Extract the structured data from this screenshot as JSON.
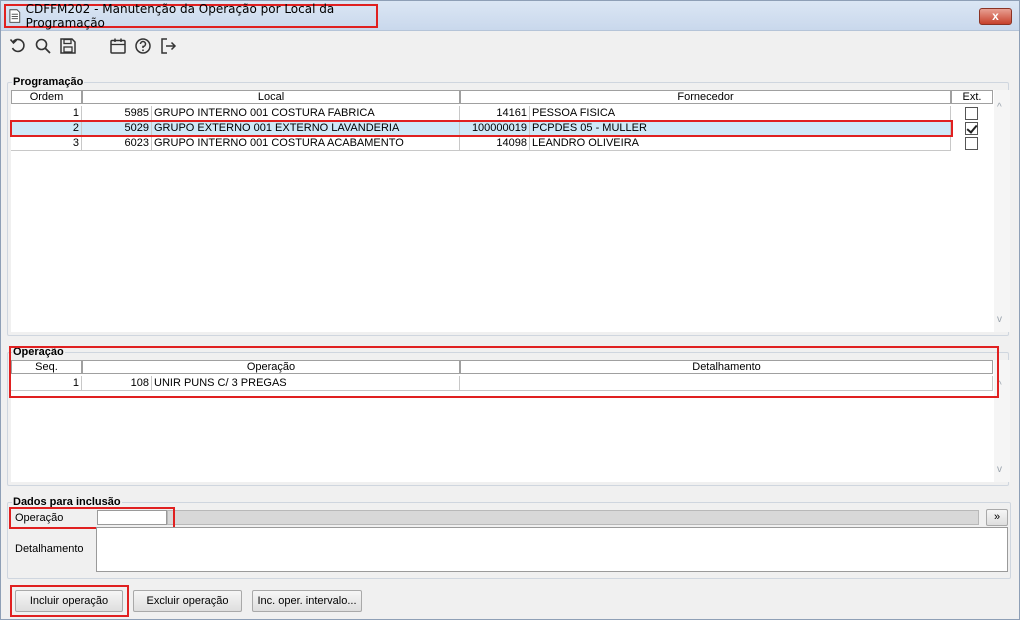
{
  "window": {
    "title": "CDFFM202 - Manutenção da Operação por Local da Programação",
    "close_label": "x"
  },
  "toolbar": {
    "icons": [
      "undo-icon",
      "search-icon",
      "save-icon",
      "calendar-icon",
      "help-icon",
      "exit-icon"
    ]
  },
  "programacao": {
    "label": "Programação",
    "columns": [
      "Ordem",
      "Local",
      "Fornecedor",
      "Ext."
    ],
    "rows": [
      {
        "ordem": "1",
        "local_cod": "5985",
        "local_nome": "GRUPO INTERNO 001 COSTURA FABRICA",
        "forn_cod": "14161",
        "forn_nome": "PESSOA FISICA",
        "ext": false
      },
      {
        "ordem": "2",
        "local_cod": "5029",
        "local_nome": "GRUPO EXTERNO 001 EXTERNO LAVANDERIA",
        "forn_cod": "100000019",
        "forn_nome": "PCPDES 05 - MULLER",
        "ext": true
      },
      {
        "ordem": "3",
        "local_cod": "6023",
        "local_nome": "GRUPO INTERNO 001 COSTURA ACABAMENTO",
        "forn_cod": "14098",
        "forn_nome": "LEANDRO OLIVEIRA",
        "ext": false
      }
    ]
  },
  "operacao": {
    "label": "Operação",
    "columns": [
      "Seq.",
      "Operação",
      "Detalhamento"
    ],
    "rows": [
      {
        "seq": "1",
        "op_cod": "108",
        "op_nome": "UNIR PUNS C/ 3 PREGAS",
        "detalhamento": ""
      }
    ]
  },
  "dados": {
    "label": "Dados para inclusão",
    "operacao_label": "Operação",
    "operacao_value": "",
    "lookup_label": "»",
    "detalhamento_label": "Detalhamento",
    "detalhamento_value": ""
  },
  "buttons": {
    "incluir": "Incluir operação",
    "excluir": "Excluir operação",
    "intervalo": "Inc. oper. intervalo..."
  },
  "colors": {
    "highlight": "#e02020",
    "selected_row": "#cfe8f7"
  }
}
